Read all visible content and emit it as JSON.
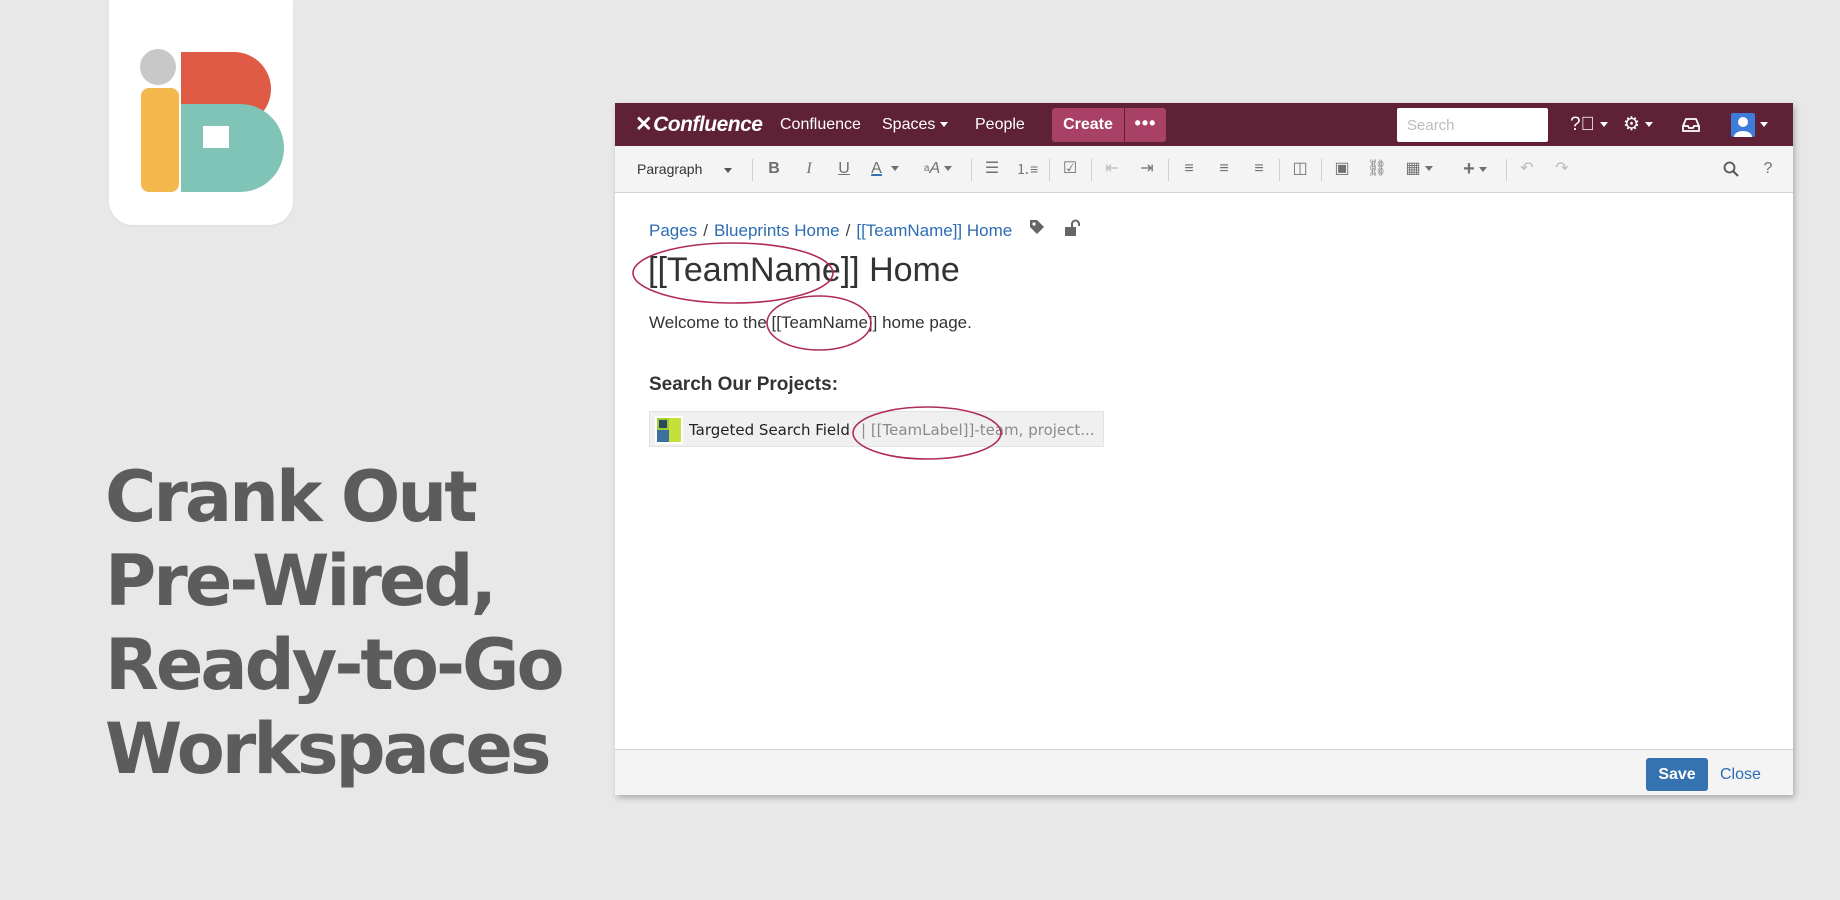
{
  "logo": {
    "name": "iB",
    "colors": {
      "red": "#df5b45",
      "teal": "#7fc4b6",
      "yellow": "#f4b84c",
      "gray": "#c8c8c8"
    }
  },
  "headline": [
    "Crank Out",
    "Pre-Wired,",
    "Ready-to-Go",
    "Workspaces"
  ],
  "confluence": {
    "topbar": {
      "brand": "Confluence",
      "home_label": "Confluence",
      "spaces_label": "Spaces",
      "people_label": "People",
      "create_label": "Create",
      "more_label": "•••",
      "search_placeholder": "Search",
      "color": "#5e2136",
      "accent": "#a84165"
    },
    "toolbar": {
      "paragraph_label": "Paragraph"
    },
    "breadcrumbs": [
      "Pages",
      "Blueprints Home",
      "[[TeamName]] Home"
    ],
    "page_title": {
      "placeholder": "[[TeamName]]",
      "rest": " Home"
    },
    "welcome": {
      "before": "Welcome to the ",
      "placeholder": "[[TeamName]]",
      "after": " home page."
    },
    "subheading": "Search Our Projects:",
    "macro": {
      "label": "Targeted Search Field",
      "params": "| [[TeamLabel]]-team, project..."
    },
    "footer": {
      "save_label": "Save",
      "close_label": "Close"
    },
    "annotation_color": "#b02a5a"
  }
}
